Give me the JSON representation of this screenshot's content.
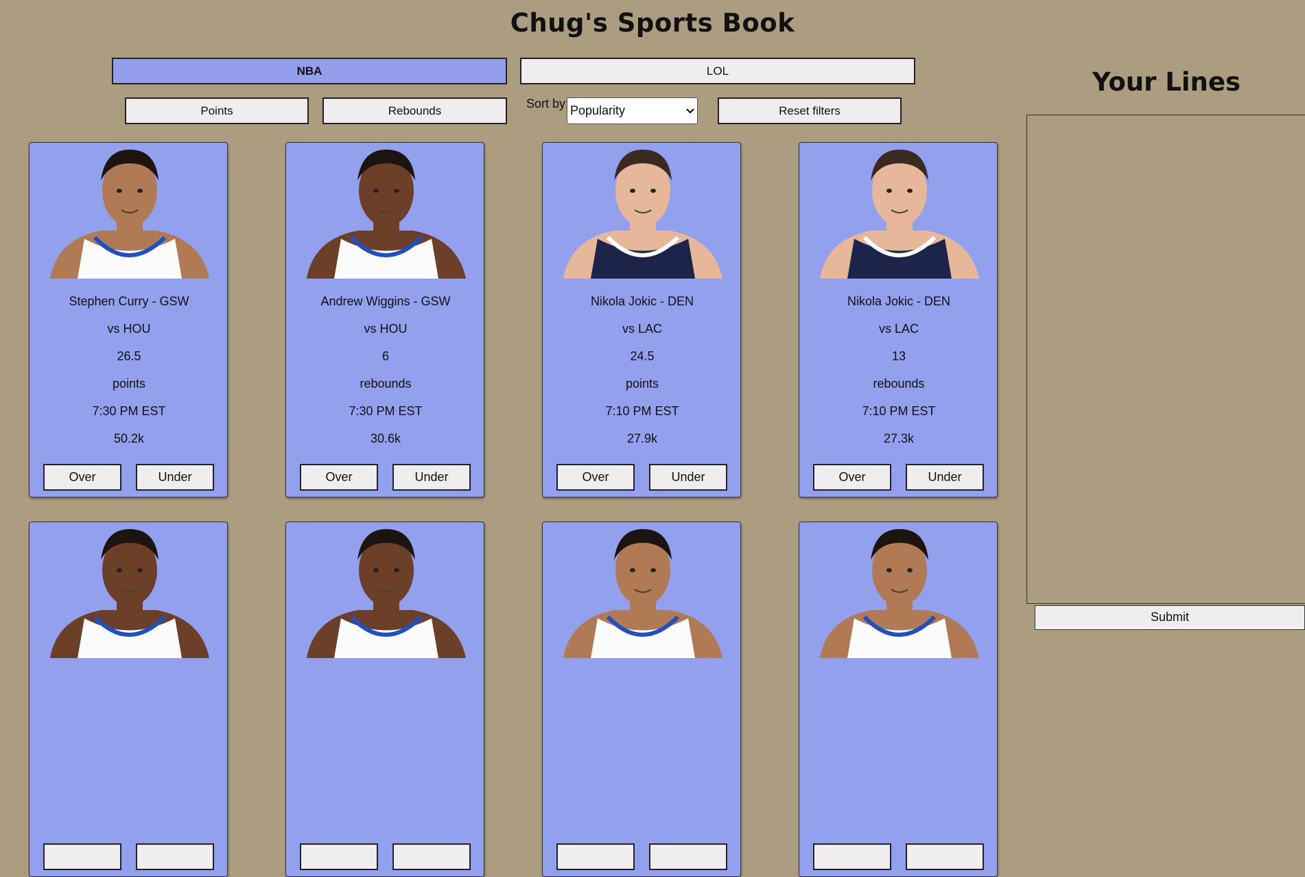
{
  "header": {
    "title": "Chug's Sports Book"
  },
  "league_tabs": [
    {
      "label": "NBA",
      "active": true
    },
    {
      "label": "LOL",
      "active": false
    }
  ],
  "stat_filters": [
    {
      "label": "Points"
    },
    {
      "label": "Rebounds"
    }
  ],
  "sort": {
    "label": "Sort by:",
    "selected": "Popularity"
  },
  "reset_label": "Reset filters",
  "sidebar": {
    "title": "Your Lines",
    "submit_label": "Submit"
  },
  "cards": [
    {
      "name": "Stephen Curry - GSW",
      "opponent": "vs HOU",
      "line": "26.5",
      "stat": "points",
      "time": "7:30 PM EST",
      "popularity": "50.2k",
      "over_label": "Over",
      "under_label": "Under",
      "jersey": "warriors"
    },
    {
      "name": "Andrew Wiggins - GSW",
      "opponent": "vs HOU",
      "line": "6",
      "stat": "rebounds",
      "time": "7:30 PM EST",
      "popularity": "30.6k",
      "over_label": "Over",
      "under_label": "Under",
      "jersey": "warriors"
    },
    {
      "name": "Nikola Jokic - DEN",
      "opponent": "vs LAC",
      "line": "24.5",
      "stat": "points",
      "time": "7:10 PM EST",
      "popularity": "27.9k",
      "over_label": "Over",
      "under_label": "Under",
      "jersey": "nuggets"
    },
    {
      "name": "Nikola Jokic - DEN",
      "opponent": "vs LAC",
      "line": "13",
      "stat": "rebounds",
      "time": "7:10 PM EST",
      "popularity": "27.3k",
      "over_label": "Over",
      "under_label": "Under",
      "jersey": "nuggets"
    },
    {
      "name": "",
      "opponent": "",
      "line": "",
      "stat": "",
      "time": "",
      "popularity": "",
      "over_label": "",
      "under_label": "",
      "jersey": ""
    },
    {
      "name": "",
      "opponent": "",
      "line": "",
      "stat": "",
      "time": "",
      "popularity": "",
      "over_label": "",
      "under_label": "",
      "jersey": ""
    },
    {
      "name": "",
      "opponent": "",
      "line": "",
      "stat": "",
      "time": "",
      "popularity": "",
      "over_label": "",
      "under_label": "",
      "jersey": ""
    },
    {
      "name": "",
      "opponent": "",
      "line": "",
      "stat": "",
      "time": "",
      "popularity": "",
      "over_label": "",
      "under_label": "",
      "jersey": ""
    }
  ],
  "colors": {
    "background": "#ad9d80",
    "accent": "#939feb",
    "button": "#efedee"
  }
}
